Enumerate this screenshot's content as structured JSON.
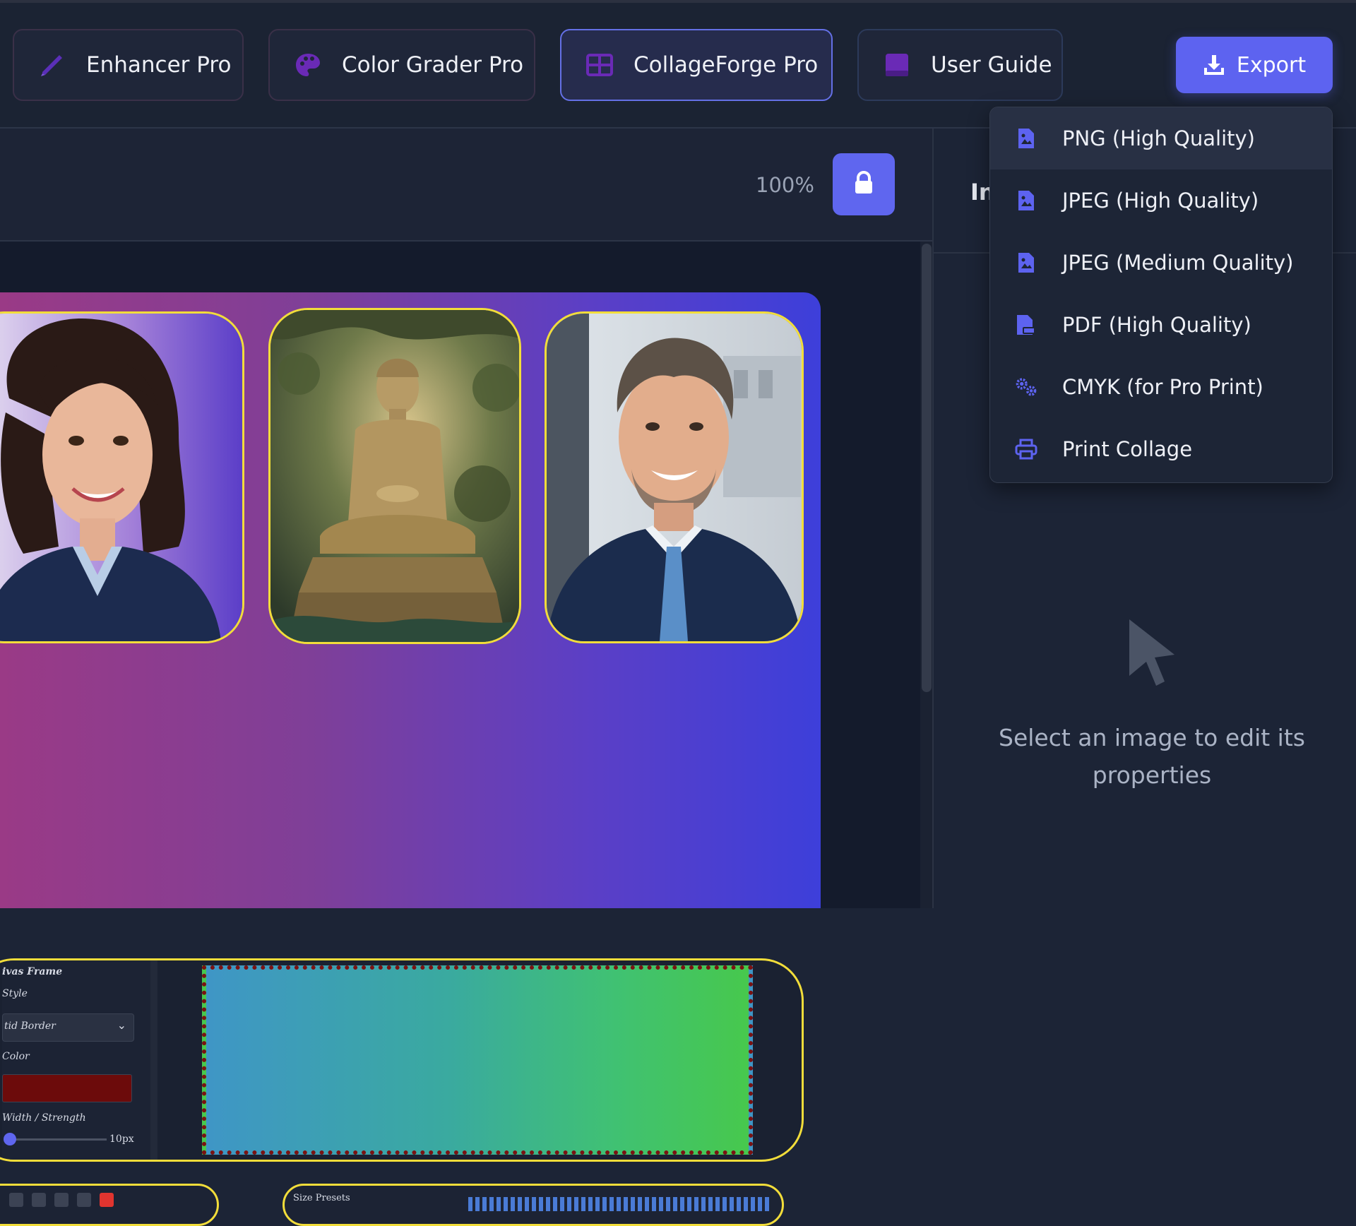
{
  "toolbar": {
    "tabs": [
      {
        "label": "Enhancer Pro",
        "icon": "pencil-icon",
        "active": false
      },
      {
        "label": "Color Grader Pro",
        "icon": "palette-icon",
        "active": false
      },
      {
        "label": "CollageForge Pro",
        "icon": "grid-icon",
        "active": true
      },
      {
        "label": "User Guide",
        "icon": "book-icon",
        "active": false
      }
    ],
    "export_label": "Export",
    "export_icon": "download-icon"
  },
  "canvas": {
    "zoom": "100%",
    "lock_icon": "lock-icon"
  },
  "right_panel": {
    "heading_partial": "In",
    "empty_state": "Select an image to edit its properties",
    "empty_icon": "cursor-arrow-icon"
  },
  "export_menu": {
    "items": [
      {
        "label": "PNG (High Quality)",
        "icon": "image-file-icon"
      },
      {
        "label": "JPEG (High Quality)",
        "icon": "image-file-icon"
      },
      {
        "label": "JPEG (Medium Quality)",
        "icon": "image-file-icon"
      },
      {
        "label": "PDF (High Quality)",
        "icon": "pdf-file-icon"
      },
      {
        "label": "CMYK (for Pro Print)",
        "icon": "gears-icon"
      },
      {
        "label": "Print Collage",
        "icon": "printer-icon"
      }
    ]
  },
  "collage": {
    "photos": [
      {
        "subject": "portrait-woman"
      },
      {
        "subject": "buddha-statue"
      },
      {
        "subject": "portrait-man"
      }
    ],
    "embedded_panel": {
      "frame_label": "ivas Frame",
      "style_label": "Style",
      "style_value": "tid Border",
      "color_label": "Color",
      "width_label": "Width / Strength",
      "width_value": "10px",
      "border_color": "#6c0b0b"
    },
    "bottom_row_label": "Size Presets"
  },
  "colors": {
    "accent": "#5d63f0",
    "frame_border": "#f2dd3a",
    "background": "#1c2436"
  }
}
